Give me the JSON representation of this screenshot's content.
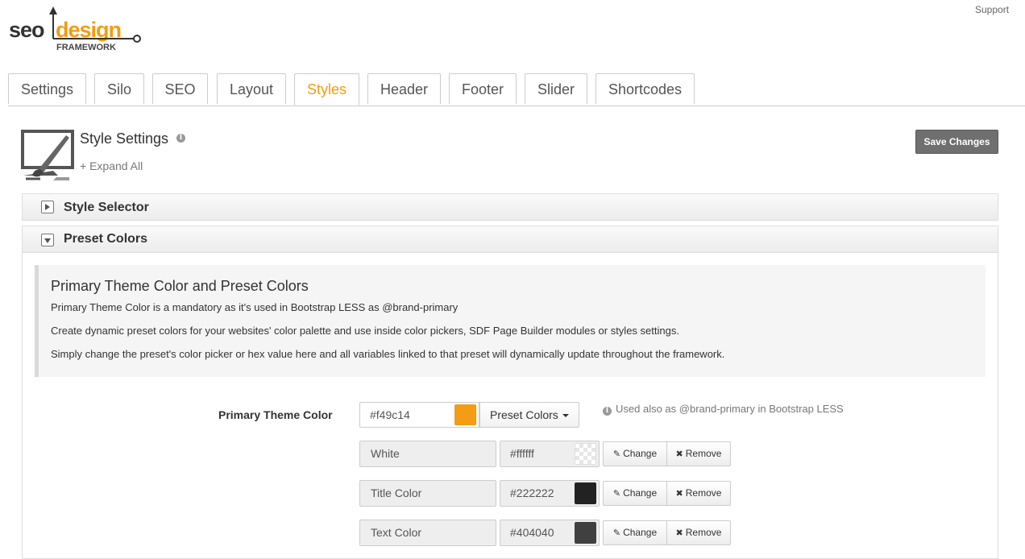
{
  "support_link": "Support",
  "logo": {
    "text_seo": "seo",
    "text_design": "design",
    "text_framework": "FRAMEWORK"
  },
  "tabs": [
    {
      "label": "Settings"
    },
    {
      "label": "Silo"
    },
    {
      "label": "SEO"
    },
    {
      "label": "Layout"
    },
    {
      "label": "Styles",
      "active": true
    },
    {
      "label": "Header"
    },
    {
      "label": "Footer"
    },
    {
      "label": "Slider"
    },
    {
      "label": "Shortcodes"
    }
  ],
  "page": {
    "title": "Style Settings",
    "info_icon": "i",
    "expand_all": "+ Expand All",
    "save_label": "Save Changes"
  },
  "panels": {
    "style_selector": {
      "label": "Style Selector",
      "state": "collapsed"
    },
    "preset_colors": {
      "label": "Preset Colors",
      "state": "expanded"
    }
  },
  "info": {
    "heading": "Primary Theme Color and Preset Colors",
    "p1": "Primary Theme Color is a mandatory as it's used in Bootstrap LESS as @brand-primary",
    "p2": "Create dynamic preset colors for your websites' color palette and use inside color pickers, SDF Page Builder modules or styles settings.",
    "p3": "Simply change the preset's color picker or hex value here and all variables linked to that preset will dynamically update throughout the framework."
  },
  "primary": {
    "label": "Primary Theme Color",
    "value": "#f49c14",
    "value_text": "#f49c14",
    "swatch_color": "#f49c14",
    "preset_button": "Preset Colors",
    "help": "Used also as @brand-primary in Bootstrap LESS"
  },
  "presets": [
    {
      "name": "White",
      "hex": "#ffffff",
      "swatch": "transparent",
      "change": "Change",
      "remove": "Remove"
    },
    {
      "name": "Title Color",
      "hex": "#222222",
      "swatch": "#222222",
      "change": "Change",
      "remove": "Remove"
    },
    {
      "name": "Text Color",
      "hex": "#404040",
      "swatch": "#404040",
      "change": "Change",
      "remove": "Remove"
    }
  ],
  "colors": {
    "accent": "#f39c12",
    "save_button": "#6f6f6f"
  }
}
